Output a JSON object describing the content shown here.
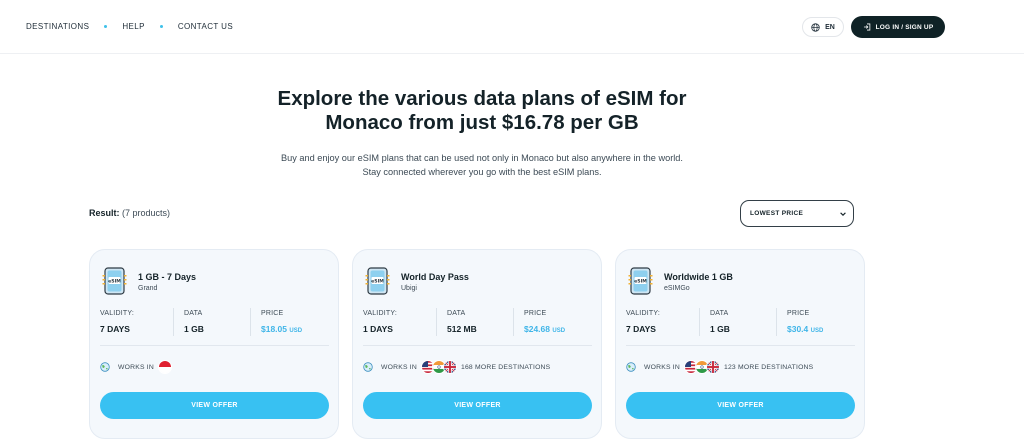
{
  "nav": {
    "items": [
      "DESTINATIONS",
      "HELP",
      "CONTACT US"
    ],
    "language": "EN",
    "login_label": "LOG IN / SIGN UP"
  },
  "hero": {
    "title_line1": "Explore the various data plans of eSIM for",
    "title_line2": "Monaco from just $16.78 per GB",
    "subtitle_line1": "Buy and enjoy our eSIM plans that can be used not only in Monaco but also anywhere in the world.",
    "subtitle_line2": "Stay connected wherever you go with the best eSIM plans."
  },
  "results": {
    "label": "Result:",
    "count": "(7 products)"
  },
  "sort": {
    "selected": "LOWEST PRICE"
  },
  "labels": {
    "validity": "VALIDITY:",
    "data": "DATA",
    "price": "PRICE",
    "works_in": "WORKS IN",
    "view_offer": "VIEW OFFER",
    "currency": "USD"
  },
  "colors": {
    "accent": "#38c1f2",
    "price": "#3fb5e8",
    "dark_button": "#0f2226",
    "card_bg": "#f4f8fc"
  },
  "plans": [
    {
      "name": "1 GB - 7 Days",
      "provider": "Grand",
      "validity": "7 DAYS",
      "data": "1 GB",
      "price": "$18.05",
      "flags": [
        "monaco-flag"
      ],
      "more": ""
    },
    {
      "name": "World Day Pass",
      "provider": "Ubigi",
      "validity": "1 DAYS",
      "data": "512 MB",
      "price": "$24.68",
      "flags": [
        "us-flag",
        "india-flag",
        "uk-flag"
      ],
      "more": "168 MORE DESTINATIONS"
    },
    {
      "name": "Worldwide 1 GB",
      "provider": "eSIMGo",
      "validity": "7 DAYS",
      "data": "1 GB",
      "price": "$30.4",
      "flags": [
        "us-flag",
        "india-flag",
        "uk-flag"
      ],
      "more": "123 MORE DESTINATIONS"
    }
  ]
}
